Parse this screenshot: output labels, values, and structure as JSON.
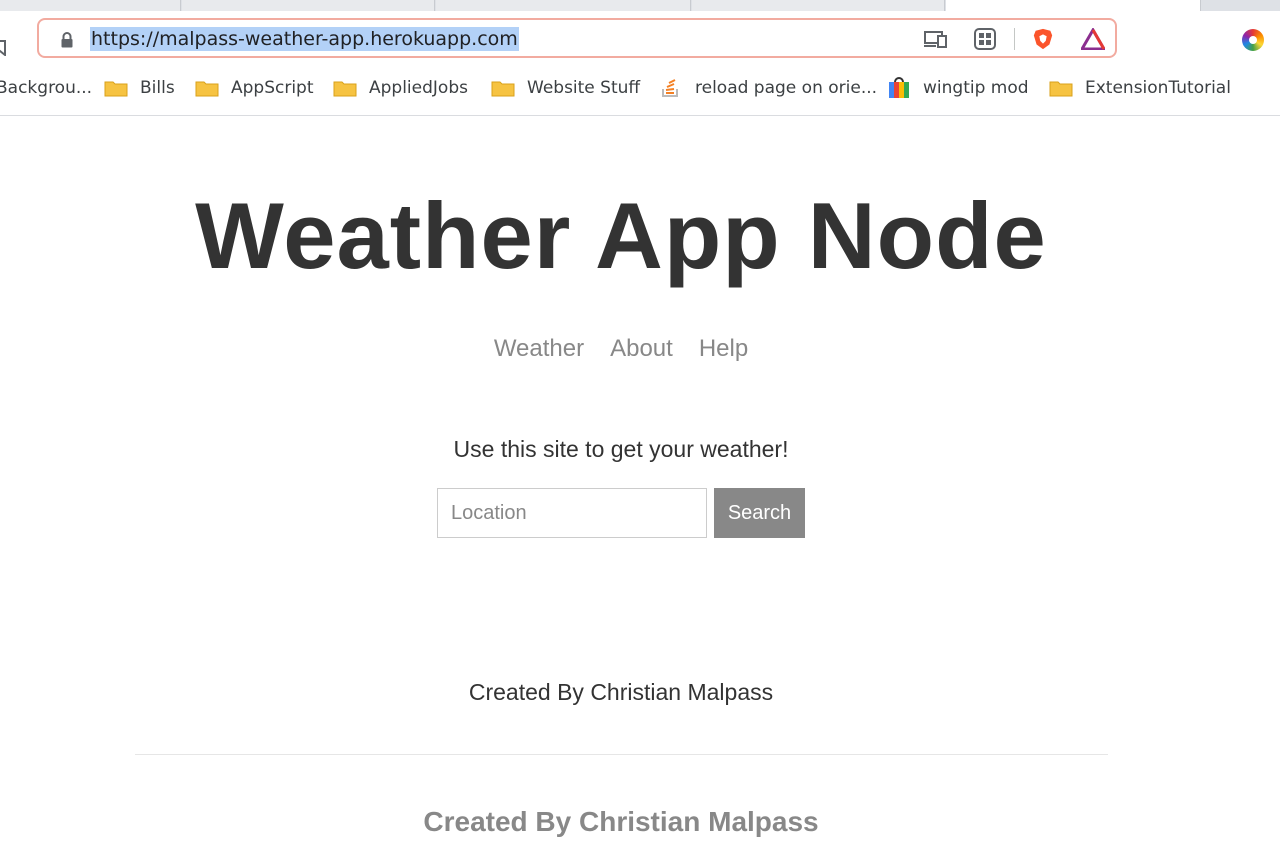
{
  "browser": {
    "url": "https://malpass-weather-app.herokuapp.com",
    "bookmarks": [
      {
        "label": "Backgrou...",
        "icon": "folder-icon"
      },
      {
        "label": "Bills",
        "icon": "folder-icon"
      },
      {
        "label": "AppScript",
        "icon": "folder-icon"
      },
      {
        "label": "AppliedJobs",
        "icon": "folder-icon"
      },
      {
        "label": "Website Stuff",
        "icon": "folder-icon"
      },
      {
        "label": "reload page on orie...",
        "icon": "stackoverflow-icon"
      },
      {
        "label": "wingtip mod",
        "icon": "shopping-bag-icon"
      },
      {
        "label": "ExtensionTutorial",
        "icon": "folder-icon"
      }
    ],
    "colors": {
      "omnibox_border": "#f2aba0",
      "url_highlight": "#b3d1f7"
    }
  },
  "page": {
    "title": "Weather App Node",
    "nav": [
      "Weather",
      "About",
      "Help"
    ],
    "intro": "Use this site to get your weather!",
    "search": {
      "placeholder": "Location",
      "value": "",
      "button_label": "Search"
    },
    "footer_text": "Created By Christian Malpass",
    "footer_heading": "Created By Christian Malpass",
    "colors": {
      "title": "#333333",
      "muted": "#888888",
      "button": "#888888"
    }
  }
}
